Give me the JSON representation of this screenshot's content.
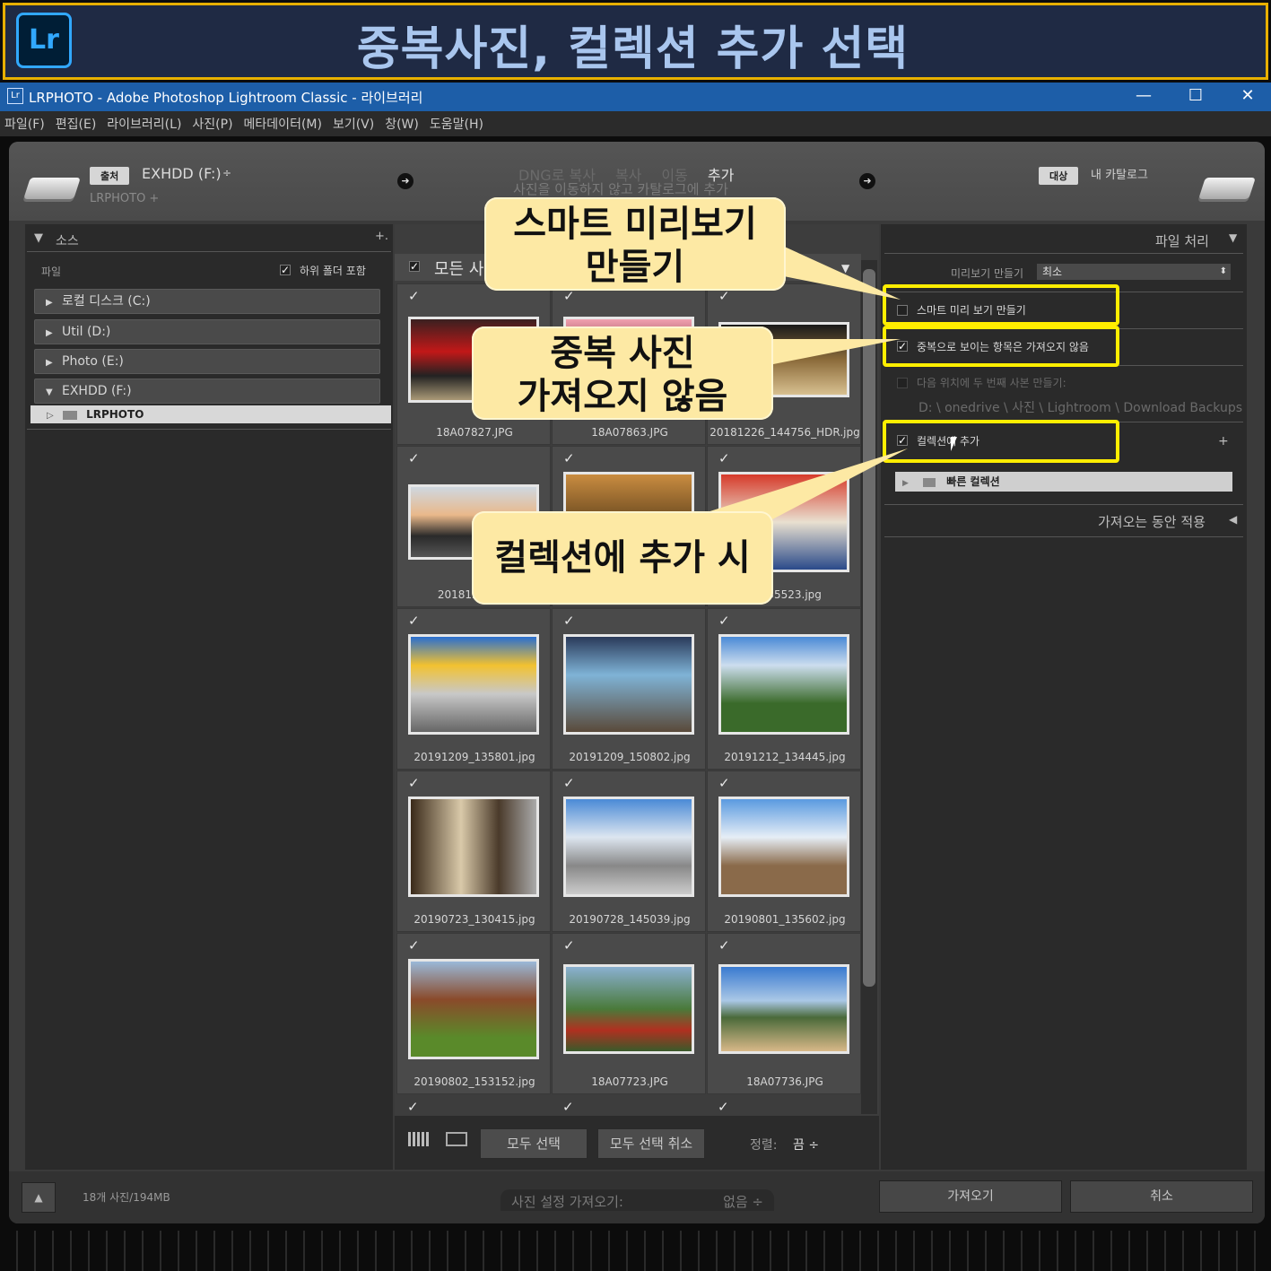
{
  "banner": {
    "logo": "Lr",
    "title": "중복사진, 컬렉션 추가 선택"
  },
  "window": {
    "icon": "Lr",
    "title": "LRPHOTO - Adobe Photoshop Lightroom Classic - 라이브러리",
    "minimize": "—",
    "maximize": "☐",
    "close": "✕"
  },
  "menu": [
    "파일(F)",
    "편집(E)",
    "라이브러리(L)",
    "사진(P)",
    "메타데이터(M)",
    "보기(V)",
    "창(W)",
    "도움말(H)"
  ],
  "topband": {
    "source_tag": "출처",
    "source_drive": "EXHDD (F:)",
    "source_drive_arrow": "÷",
    "source_path": "LRPHOTO +",
    "modes": [
      "DNG로 복사",
      "복사",
      "이동",
      "추가"
    ],
    "mode_subtitle": "사진을 이동하지 않고 카탈로그에 추가",
    "dest_tag": "대상",
    "dest_label": "내 카탈로그"
  },
  "left": {
    "header": "소스",
    "header_plus": "+.",
    "files_label": "파일",
    "include_subfolders": "하위 폴더 포함",
    "drives": [
      "로컬 디스크 (C:)",
      "Util (D:)",
      "Photo (E:)",
      "EXHDD (F:)"
    ],
    "folder": "LRPHOTO"
  },
  "grid": {
    "header_check_label": "모든 사",
    "captions": [
      "18A07827.JPG",
      "18A07863.JPG",
      "20181226_144756_HDR.jpg",
      "20181226_17",
      "",
      "9_135523.jpg",
      "20191209_135801.jpg",
      "20191209_150802.jpg",
      "20191212_134445.jpg",
      "20190723_130415.jpg",
      "20190728_145039.jpg",
      "20190801_135602.jpg",
      "20190802_153152.jpg",
      "18A07723.JPG",
      "18A07736.JPG"
    ],
    "select_all": "모두 선택",
    "deselect_all": "모두 선택 취소",
    "sort_label": "정렬:",
    "sort_value": "끔 ÷"
  },
  "right": {
    "header": "파일 처리",
    "preview_label": "미리보기 만들기",
    "preview_value": "최소",
    "smart_preview": "스마트 미리 보기 만들기",
    "no_duplicates": "중복으로 보이는 항목은 가져오지 않음",
    "second_copy": "다음 위치에 두 번째 사본 만들기:",
    "second_copy_path": "D: \\ onedrive \\ 사진 \\ Lightroom \\ Download Backups",
    "add_collection": "컬렉션에 추가",
    "collection_plus": "+",
    "quick_collection": "빠른 컬렉션",
    "apply_header": "가져오는 동안 적용"
  },
  "footer": {
    "count": "18개 사진/194MB",
    "preset_label": "사진 설정 가져오기:",
    "preset_value": "없음 ÷",
    "import": "가져오기",
    "cancel": "취소"
  },
  "callouts": {
    "smart": [
      "스마트 미리보기",
      "만들기"
    ],
    "dup": [
      "중복 사진",
      "가져오지 않음"
    ],
    "collection": "컬렉션에 추가 시"
  },
  "colors": {
    "banner_bg": "#1f2a44",
    "banner_border": "#e8b000",
    "banner_text": "#a9c6ee",
    "titlebar": "#1d5ea8",
    "callout": "#fde9a4",
    "highlight": "#ffee00"
  }
}
